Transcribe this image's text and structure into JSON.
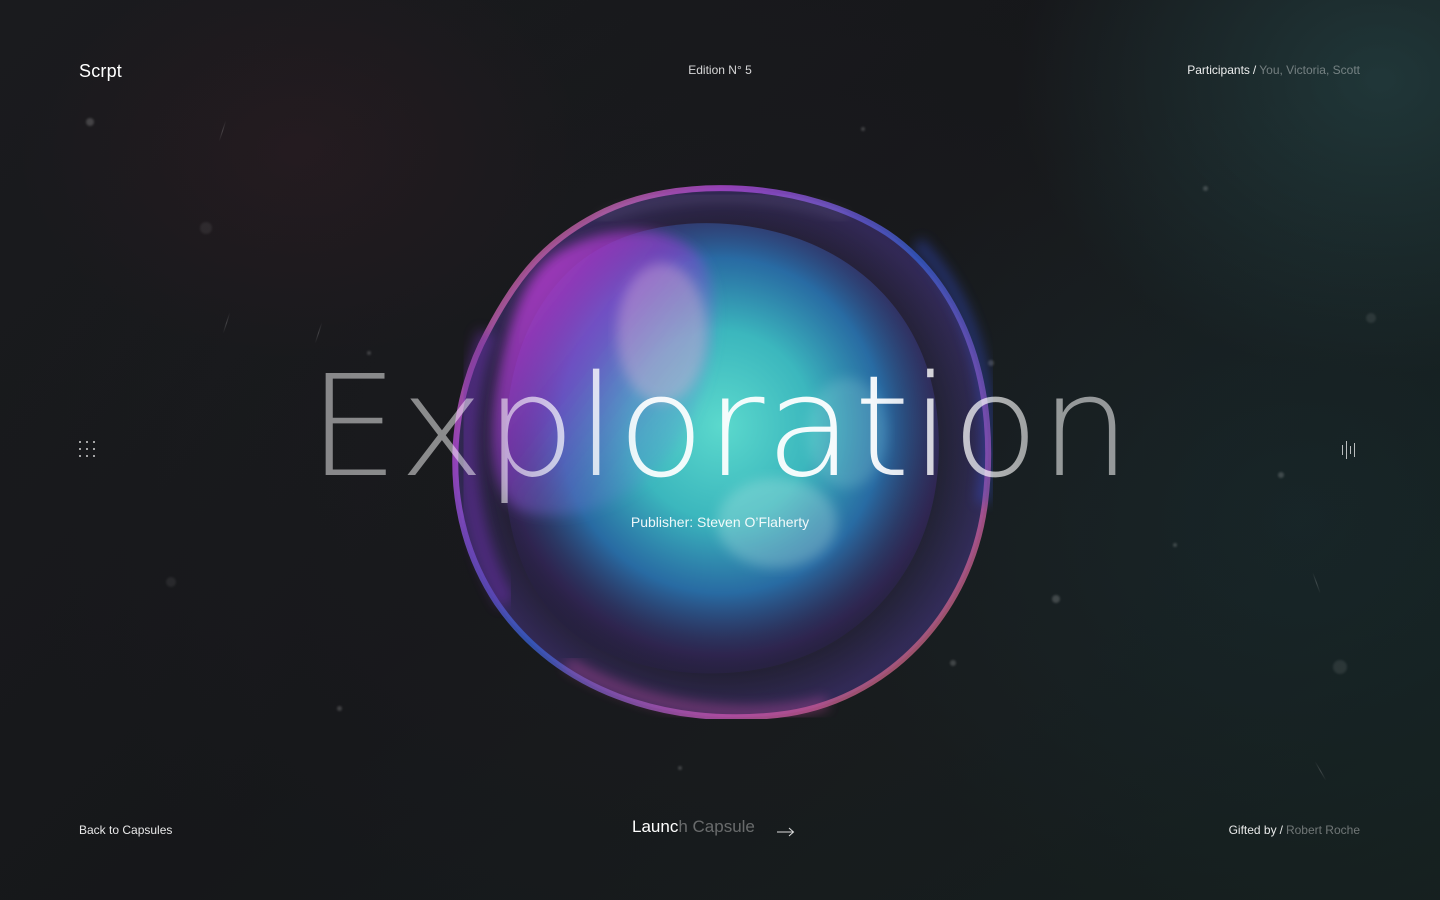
{
  "header": {
    "logo": "Scrpt",
    "edition": "Edition N° 5",
    "participants_label": "Participants",
    "participants_separator": "/",
    "participants_names": "You, Victoria, Scott"
  },
  "side": {
    "left_icon": "grid-dots-icon",
    "right_icon": "sound-wave-icon"
  },
  "hero": {
    "title": "Exploration",
    "publisher": "Publisher: Steven O’Flaherty",
    "image": "iridescent-bubble"
  },
  "footer": {
    "back_label": "Back to Capsules",
    "launch_label_part1": "Launc",
    "launch_label_part2": "h Capsule",
    "launch_icon": "arrow-right-icon",
    "gifted_label": "Gifted by",
    "gifted_separator": "/",
    "gifted_name": "Robert Roche"
  },
  "colors": {
    "background": "#17191b",
    "text": "#ffffff",
    "muted_text": "#6a6c6e",
    "bubble_magenta": "#c33bd8",
    "bubble_cyan": "#3fd6d0",
    "bubble_blue": "#4b5fe0"
  }
}
